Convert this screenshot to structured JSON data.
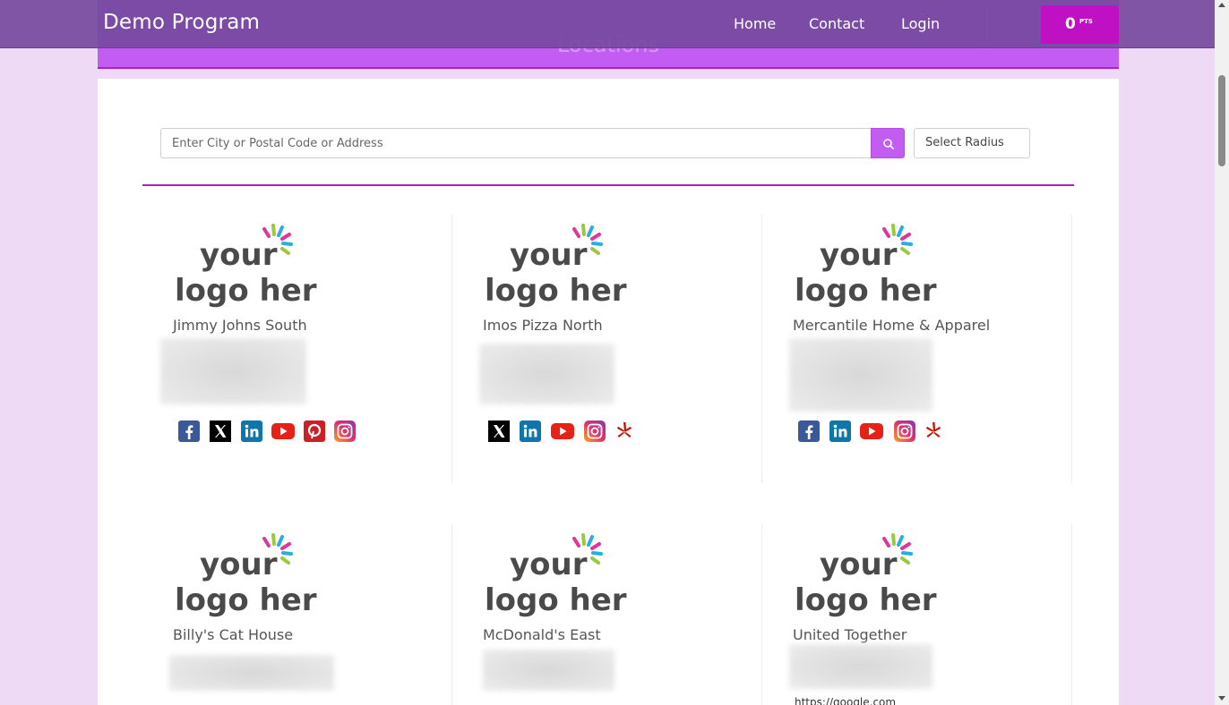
{
  "header": {
    "brand": "Demo Program",
    "nav": {
      "home": "Home",
      "contact": "Contact",
      "login": "Login"
    },
    "points": {
      "value": "0",
      "unit": "PTS"
    }
  },
  "banner": {
    "title": "Locations"
  },
  "search": {
    "placeholder": "Enter City or Postal Code or Address",
    "button_icon": "search-icon"
  },
  "radius": {
    "label": "Select Radius"
  },
  "logo": {
    "line1": "your",
    "line2": "logo here"
  },
  "locations": [
    {
      "name": "Jimmy Johns South",
      "socials": [
        "facebook-icon",
        "x-icon",
        "linkedin-icon",
        "youtube-icon",
        "pinterest-icon",
        "instagram-icon"
      ]
    },
    {
      "name": "Imos Pizza North",
      "socials": [
        "x-icon",
        "linkedin-icon",
        "youtube-icon",
        "instagram-icon",
        "yelp-icon"
      ]
    },
    {
      "name": "Mercantile Home & Apparel",
      "socials": [
        "facebook-icon",
        "linkedin-icon",
        "youtube-icon",
        "instagram-icon",
        "yelp-icon"
      ]
    },
    {
      "name": "Billy's Cat House",
      "socials": []
    },
    {
      "name": "McDonald's East",
      "socials": []
    },
    {
      "name": "United Together",
      "socials": [],
      "partial_text": "https://google.com"
    }
  ],
  "colors": {
    "header": "#764a9e",
    "banner": "#c35cf2",
    "points_button": "#c010c4",
    "accent_line": "#b020b0",
    "page_bg": "#efdaf5"
  }
}
